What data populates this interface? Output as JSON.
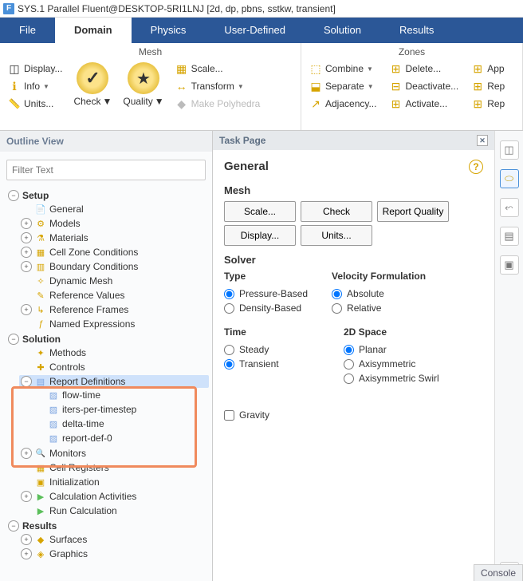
{
  "titlebar": {
    "app_initial": "F",
    "title": "SYS.1 Parallel Fluent@DESKTOP-5RI1LNJ  [2d, dp, pbns, sstkw, transient]"
  },
  "tabs": {
    "file": "File",
    "domain": "Domain",
    "physics": "Physics",
    "user": "User-Defined",
    "solution": "Solution",
    "results": "Results"
  },
  "ribbon": {
    "mesh_group": "Mesh",
    "zones_group": "Zones",
    "display": "Display...",
    "info": "Info",
    "units": "Units...",
    "check": "Check",
    "quality": "Quality",
    "scale": "Scale...",
    "transform": "Transform",
    "poly": "Make Polyhedra",
    "combine": "Combine",
    "separate": "Separate",
    "adjacency": "Adjacency...",
    "delete": "Delete...",
    "deactivate": "Deactivate...",
    "activate": "Activate...",
    "app": "App",
    "rep1": "Rep",
    "rep2": "Rep"
  },
  "outline": {
    "header": "Outline View",
    "filter_placeholder": "Filter Text",
    "setup": "Setup",
    "general": "General",
    "models": "Models",
    "materials": "Materials",
    "czc": "Cell Zone Conditions",
    "bc": "Boundary Conditions",
    "dynmesh": "Dynamic Mesh",
    "refval": "Reference Values",
    "reffr": "Reference Frames",
    "named": "Named Expressions",
    "solution": "Solution",
    "methods": "Methods",
    "controls": "Controls",
    "repdef": "Report Definitions",
    "rd": [
      "flow-time",
      "iters-per-timestep",
      "delta-time",
      "report-def-0"
    ],
    "monitors": "Monitors",
    "cellreg": "Cell Registers",
    "init": "Initialization",
    "calcact": "Calculation Activities",
    "runcalc": "Run Calculation",
    "results": "Results",
    "surfaces": "Surfaces",
    "graphics": "Graphics"
  },
  "task": {
    "header": "Task Page",
    "title": "General",
    "mesh": "Mesh",
    "btn_scale": "Scale...",
    "btn_check": "Check",
    "btn_rq": "Report Quality",
    "btn_display": "Display...",
    "btn_units": "Units...",
    "solver": "Solver",
    "type_label": "Type",
    "type_pb": "Pressure-Based",
    "type_db": "Density-Based",
    "vel_label": "Velocity Formulation",
    "vel_abs": "Absolute",
    "vel_rel": "Relative",
    "time_label": "Time",
    "time_steady": "Steady",
    "time_trans": "Transient",
    "space_label": "2D Space",
    "sp_planar": "Planar",
    "sp_axi": "Axisymmetric",
    "sp_swirl": "Axisymmetric Swirl",
    "gravity": "Gravity"
  },
  "console": "Console"
}
